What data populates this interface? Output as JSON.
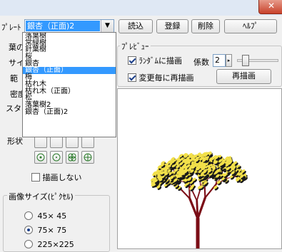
{
  "window": {
    "close_glyph": "✕"
  },
  "toolbar": {
    "template_label": "ﾌﾟﾚｰﾄ",
    "template_value": "銀杏（正面)2",
    "load": "読込",
    "register": "登録",
    "delete": "削除",
    "help": "ﾍﾙﾌﾟ"
  },
  "dropdown": {
    "items": [
      "落葉樹",
      "常緑樹",
      "針葉樹",
      "桜",
      "銀杏",
      "銀杏（正面）",
      "梅",
      "枯れ木",
      "枯れ木（正面）",
      "松",
      "落葉樹2",
      "銀杏（正面)2"
    ],
    "selected_index": 5
  },
  "left_panel": {
    "label_leaf": "葉の",
    "label_size": "サイ",
    "label_range": "範",
    "label_density": "密度",
    "label_start": "スター",
    "label_shape": "形状",
    "no_draw": "描画しない",
    "no_draw_checked": false
  },
  "preview": {
    "title": "ﾌﾟﾚﾋﾞｭｰ",
    "random_label": "ﾗﾝﾀﾞﾑに描画",
    "random_checked": true,
    "coef_label": "係数",
    "coef_value": "2",
    "coef_level": 0.1,
    "redraw_on_change_label": "変更毎に再描画",
    "redraw_on_change_checked": true,
    "redraw_button": "再描画"
  },
  "image_size": {
    "title": "画像サイズ(ﾋﾟｸｾﾙ)",
    "options": [
      "45× 45",
      "75× 75",
      "225×225"
    ],
    "selected_index": 1
  },
  "colors": {
    "trunk": "#7b0d16",
    "leaf": "#f2e04a",
    "leaf_shadow": "#1a1a1a",
    "selection": "#3399ff"
  }
}
